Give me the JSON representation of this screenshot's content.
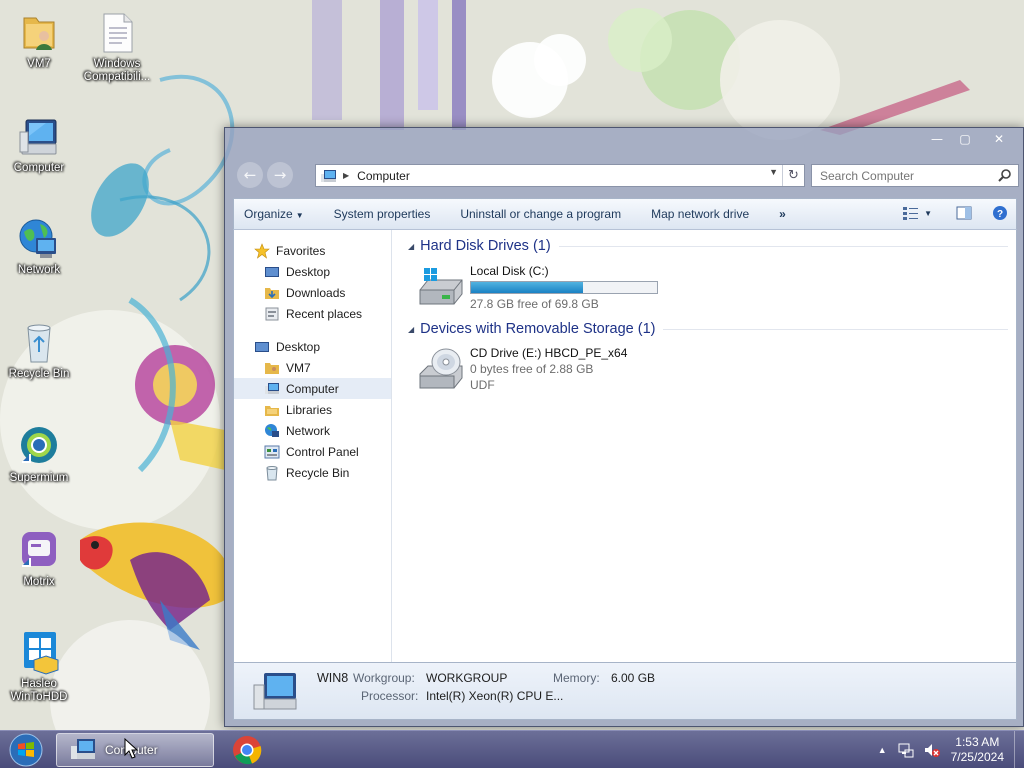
{
  "desktop": {
    "icons": [
      {
        "label": "VM7",
        "icon": "user-folder-icon"
      },
      {
        "label": "Windows\nCompatibili...",
        "icon": "text-file-icon"
      },
      {
        "label": "Computer",
        "icon": "computer-icon"
      },
      {
        "label": "Network",
        "icon": "network-globe-icon"
      },
      {
        "label": "Recycle Bin",
        "icon": "recycle-bin-icon"
      },
      {
        "label": "Supermium",
        "icon": "supermium-browser-icon"
      },
      {
        "label": "Motrix",
        "icon": "motrix-icon"
      },
      {
        "label": "Hasleo\nWinToHDD",
        "icon": "hasleo-wintohdd-icon"
      }
    ]
  },
  "window": {
    "caption_buttons": {
      "minimize": "—",
      "maximize": "▢",
      "close": "✕"
    },
    "address": {
      "location": "Computer"
    },
    "search": {
      "placeholder": "Search Computer"
    },
    "toolbar": {
      "organize": "Organize",
      "system_properties": "System properties",
      "uninstall": "Uninstall or change a program",
      "map_drive": "Map network drive",
      "more": "»"
    },
    "nav": {
      "favorites": "Favorites",
      "fav_items": [
        "Desktop",
        "Downloads",
        "Recent places"
      ],
      "desktop": "Desktop",
      "tree_items": [
        "VM7",
        "Computer",
        "Libraries",
        "Network",
        "Control Panel",
        "Recycle Bin"
      ],
      "selected": "Computer"
    },
    "groups": {
      "hdd": {
        "title": "Hard Disk Drives (1)",
        "drives": [
          {
            "name": "Local Disk (C:)",
            "free_text": "27.8 GB free of 69.8 GB",
            "used_fraction": 0.6
          }
        ]
      },
      "removable": {
        "title": "Devices with Removable Storage (1)",
        "drives": [
          {
            "name": "CD Drive (E:) HBCD_PE_x64",
            "free_text": "0 bytes free of 2.88 GB",
            "fs": "UDF"
          }
        ]
      }
    },
    "details": {
      "computer_name": "WIN8",
      "workgroup_label": "Workgroup:",
      "workgroup": "WORKGROUP",
      "memory_label": "Memory:",
      "memory": "6.00 GB",
      "processor_label": "Processor:",
      "processor": "Intel(R) Xeon(R) CPU E..."
    }
  },
  "taskbar": {
    "active_app": "Computer",
    "clock_time": "1:53 AM",
    "clock_date": "7/25/2024",
    "tray_expand": "▲"
  },
  "colors": {
    "group_header": "#1e3287",
    "nav_selected": "#e5ecf6",
    "progress_fill": "#2693d0",
    "taskbar": "#565886"
  }
}
